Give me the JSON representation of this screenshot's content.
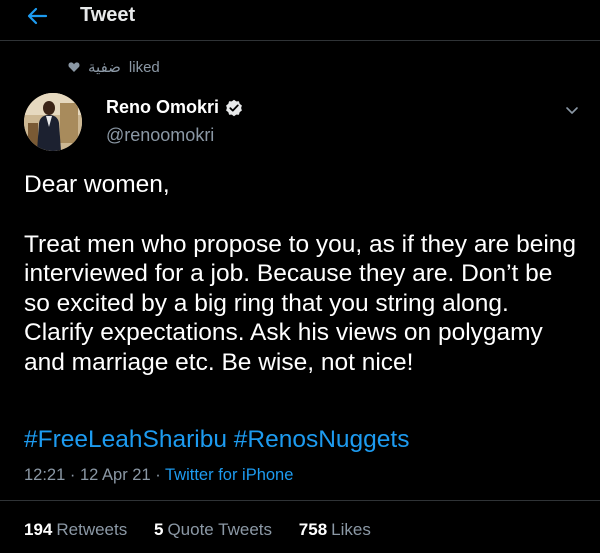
{
  "header": {
    "title": "Tweet",
    "back_icon": "arrow-left-icon"
  },
  "social_context": {
    "user": "ضفية",
    "action": "liked",
    "icon": "heart-icon"
  },
  "author": {
    "name": "Reno Omokri",
    "handle": "@renoomokri",
    "verified": true
  },
  "tweet": {
    "paragraphs": [
      "Dear women,",
      "Treat men who propose to you, as if they are being interviewed for a job. Because they are. Don’t be so excited by a big ring that you string along. Clarify expectations. Ask his views on polygamy and marriage etc. Be wise, not nice!"
    ],
    "hashtags": [
      "#FreeLeahSharibu",
      "#RenosNuggets"
    ],
    "time": "12:21",
    "date": "12 Apr 21",
    "source": "Twitter for iPhone"
  },
  "stats": {
    "retweets": "194",
    "retweets_label": "Retweets",
    "quotes": "5",
    "quotes_label": "Quote Tweets",
    "likes": "758",
    "likes_label": "Likes"
  },
  "colors": {
    "background": "#000000",
    "accent": "#1d9bf0",
    "muted": "#8b98a5",
    "divider": "#2f3336"
  }
}
